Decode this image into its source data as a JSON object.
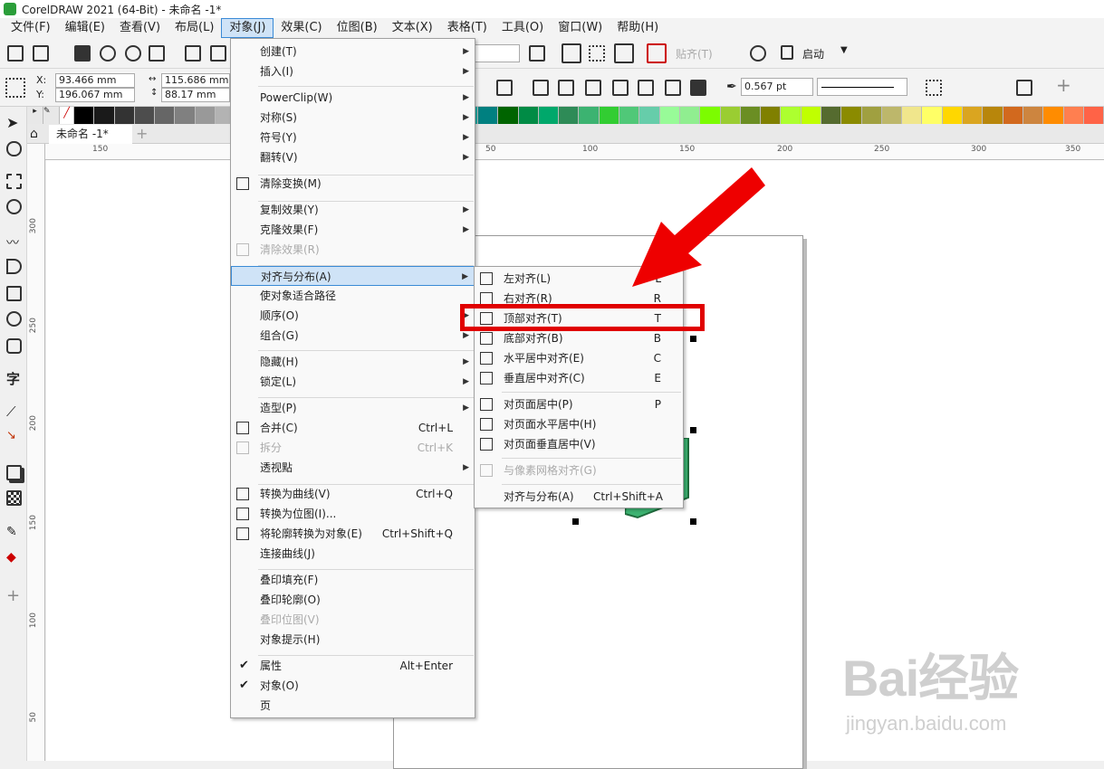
{
  "window": {
    "title": "CorelDRAW 2021 (64-Bit) - 未命名 -1*"
  },
  "menubar": {
    "items": [
      "文件(F)",
      "编辑(E)",
      "查看(V)",
      "布局(L)",
      "对象(J)",
      "效果(C)",
      "位图(B)",
      "文本(X)",
      "表格(T)",
      "工具(O)",
      "窗口(W)",
      "帮助(H)"
    ],
    "active": "对象(J)"
  },
  "toolbar": {
    "paste_label": "贴齐(T)",
    "launch_label": "启动"
  },
  "propertybar": {
    "x_label": "X:",
    "x_value": "93.466 mm",
    "y_label": "Y:",
    "y_value": "196.067 mm",
    "w_value": "115.686 mm",
    "h_value": "88.17 mm",
    "outline_width": "0.567 pt"
  },
  "document_tab": {
    "label": "未命名 -1*"
  },
  "hruler": {
    "labels": [
      "150",
      "50",
      "100",
      "150",
      "200",
      "250",
      "300",
      "350"
    ]
  },
  "vruler": {
    "labels": [
      "300",
      "250",
      "200",
      "150",
      "100",
      "50"
    ]
  },
  "palette": {
    "colors": [
      "#000000",
      "#1a1a1a",
      "#333333",
      "#4d4d4d",
      "#666666",
      "#808080",
      "#999999",
      "#b3b3b3",
      "#cccccc",
      "#7b68ee",
      "#6a5acd",
      "#4169e1",
      "#0000cd",
      "#000080",
      "#1e3a8a",
      "#2f5fa8",
      "#00bfff",
      "#40e0d0",
      "#00ced1",
      "#20b2aa",
      "#008080",
      "#006400",
      "#008b45",
      "#00a86b",
      "#2e8b57",
      "#3cb371",
      "#32cd32",
      "#50c878",
      "#66cdaa",
      "#98fb98",
      "#90ee90",
      "#7cfc00",
      "#9acd32",
      "#6b8e23",
      "#808000",
      "#adff2f",
      "#c0ff00",
      "#556b2f",
      "#8b8b00",
      "#a0a040",
      "#bdb76b",
      "#f0e68c",
      "#ffff66",
      "#ffd700",
      "#daa520",
      "#b8860b",
      "#d2691e",
      "#cd853f",
      "#ff8c00",
      "#ff7f50",
      "#ff6347"
    ]
  },
  "object_menu": {
    "items": [
      {
        "label": "创建(T)",
        "arrow": true
      },
      {
        "label": "插入(I)",
        "arrow": true
      },
      {
        "label": "PowerClip(W)",
        "arrow": true
      },
      {
        "label": "对称(S)",
        "arrow": true
      },
      {
        "label": "符号(Y)",
        "arrow": true
      },
      {
        "label": "翻转(V)",
        "arrow": true
      },
      {
        "label": "清除变换(M)"
      },
      {
        "label": "复制效果(Y)",
        "arrow": true
      },
      {
        "label": "克隆效果(F)",
        "arrow": true
      },
      {
        "label": "清除效果(R)",
        "disabled": true
      },
      {
        "label": "对齐与分布(A)",
        "arrow": true,
        "highlighted": true
      },
      {
        "label": "使对象适合路径"
      },
      {
        "label": "顺序(O)",
        "arrow": true
      },
      {
        "label": "组合(G)",
        "arrow": true
      },
      {
        "label": "隐藏(H)",
        "arrow": true
      },
      {
        "label": "锁定(L)",
        "arrow": true
      },
      {
        "label": "造型(P)",
        "arrow": true
      },
      {
        "label": "合并(C)",
        "shortcut": "Ctrl+L"
      },
      {
        "label": "拆分",
        "shortcut": "Ctrl+K",
        "disabled": true
      },
      {
        "label": "透视點",
        "arrow": true
      },
      {
        "label": "转换为曲线(V)",
        "shortcut": "Ctrl+Q"
      },
      {
        "label": "转换为位图(I)..."
      },
      {
        "label": "将轮廓转换为对象(E)",
        "shortcut": "Ctrl+Shift+Q"
      },
      {
        "label": "连接曲线(J)"
      },
      {
        "label": "叠印填充(F)"
      },
      {
        "label": "叠印轮廓(O)"
      },
      {
        "label": "叠印位图(V)",
        "disabled": true
      },
      {
        "label": "对象提示(H)"
      },
      {
        "label": "属性",
        "shortcut": "Alt+Enter",
        "checked": true
      },
      {
        "label": "对象(O)",
        "checked": true
      },
      {
        "label": "页"
      }
    ]
  },
  "align_submenu": {
    "items": [
      {
        "label": "左对齐(L)",
        "shortcut": "L"
      },
      {
        "label": "右对齐(R)",
        "shortcut": "R"
      },
      {
        "label": "顶部对齐(T)",
        "shortcut": "T",
        "highlighted": true
      },
      {
        "label": "底部对齐(B)",
        "shortcut": "B"
      },
      {
        "label": "水平居中对齐(E)",
        "shortcut": "C"
      },
      {
        "label": "垂直居中对齐(C)",
        "shortcut": "E"
      },
      {
        "label": "对页面居中(P)",
        "shortcut": "P"
      },
      {
        "label": "对页面水平居中(H)"
      },
      {
        "label": "对页面垂直居中(V)"
      },
      {
        "label": "与像素网格对齐(G)",
        "disabled": true
      },
      {
        "label": "对齐与分布(A)",
        "shortcut": "Ctrl+Shift+A"
      }
    ]
  },
  "annotation": {
    "arrow_color": "#e00000",
    "box_color": "#e00000"
  },
  "watermark": {
    "text": "Bai经验",
    "subtext": "jingyan.baidu.com"
  }
}
